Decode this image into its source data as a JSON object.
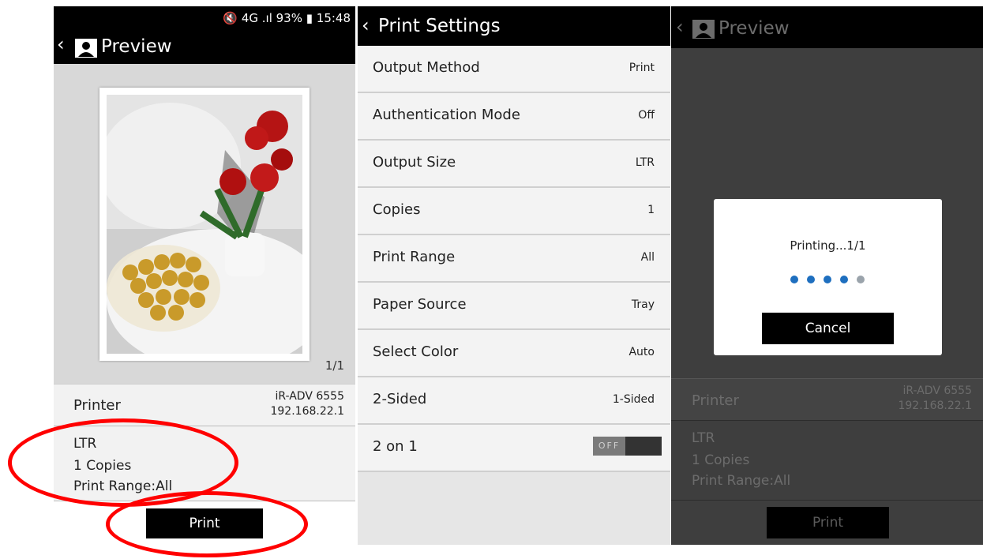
{
  "preview_screen": {
    "status_bar": "🔇 4G .ıl 93% ▮ 15:48",
    "back_glyph": "‹",
    "title": "Preview",
    "page_indicator": "1/1",
    "printer_label": "Printer",
    "printer_model": "iR-ADV 6555",
    "printer_ip": "192.168.22.1",
    "summary": {
      "size": "LTR",
      "copies": "1 Copies",
      "range": "Print Range:All"
    },
    "print_button": "Print",
    "annotation_color": "#ff0000"
  },
  "settings_screen": {
    "back_glyph": "‹",
    "title": "Print Settings",
    "rows": [
      {
        "label": "Output Method",
        "value": "Print"
      },
      {
        "label": "Authentication Mode",
        "value": "Off"
      },
      {
        "label": "Output Size",
        "value": "LTR"
      },
      {
        "label": "Copies",
        "value": "1"
      },
      {
        "label": "Print Range",
        "value": "All"
      },
      {
        "label": "Paper Source",
        "value": "Tray"
      },
      {
        "label": "Select Color",
        "value": "Auto"
      },
      {
        "label": "2-Sided",
        "value": "1-Sided"
      },
      {
        "label": "2 on 1",
        "toggle": "OFF"
      }
    ]
  },
  "printing_screen": {
    "back_glyph": "‹",
    "title": "Preview",
    "dialog_text": "Printing...1/1",
    "progress_dots_total": 5,
    "progress_dots_active": 4,
    "cancel_button": "Cancel",
    "printer_label": "Printer",
    "printer_model": "iR-ADV 6555",
    "printer_ip": "192.168.22.1",
    "summary": {
      "size": "LTR",
      "copies": "1 Copies",
      "range": "Print Range:All"
    },
    "print_button": "Print"
  },
  "colors": {
    "accent_blue": "#1e6fbf",
    "inactive_dot": "#9aa3ab",
    "topbar": "#000000"
  }
}
